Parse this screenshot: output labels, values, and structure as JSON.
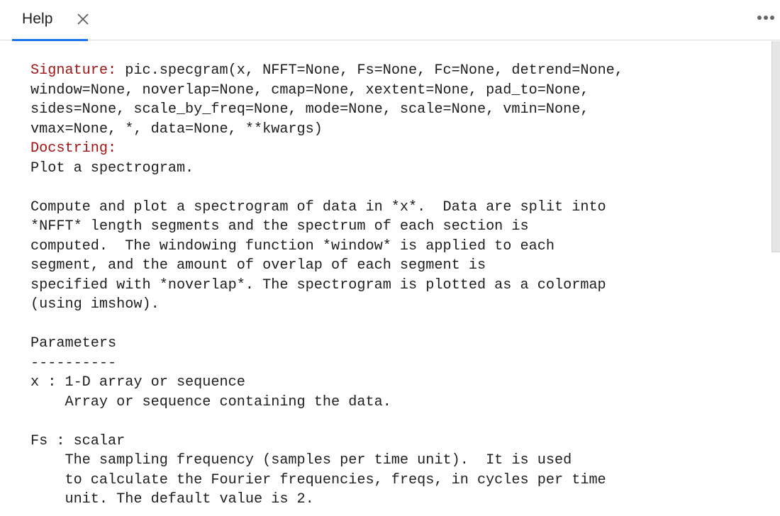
{
  "tab": {
    "label": "Help",
    "close_icon": "close-icon",
    "accent_color": "#1a73e8"
  },
  "toolbar": {
    "more_icon": "more-horizontal-icon"
  },
  "help": {
    "signature_label": "Signature:",
    "signature_lines": [
      " pic.specgram(x, NFFT=None, Fs=None, Fc=None, detrend=None,",
      "window=None, noverlap=None, cmap=None, xextent=None, pad_to=None,",
      "sides=None, scale_by_freq=None, mode=None, scale=None, vmin=None,",
      "vmax=None, *, data=None, **kwargs)"
    ],
    "docstring_label": "Docstring:",
    "docstring_lines": [
      "Plot a spectrogram.",
      "",
      "Compute and plot a spectrogram of data in *x*.  Data are split into",
      "*NFFT* length segments and the spectrum of each section is",
      "computed.  The windowing function *window* is applied to each",
      "segment, and the amount of overlap of each segment is",
      "specified with *noverlap*. The spectrogram is plotted as a colormap",
      "(using imshow).",
      "",
      "Parameters",
      "----------",
      "x : 1-D array or sequence",
      "    Array or sequence containing the data.",
      "",
      "Fs : scalar",
      "    The sampling frequency (samples per time unit).  It is used",
      "    to calculate the Fourier frequencies, freqs, in cycles per time",
      "    unit. The default value is 2."
    ],
    "label_color": "#a31515",
    "text_color": "#1e1e1e"
  }
}
